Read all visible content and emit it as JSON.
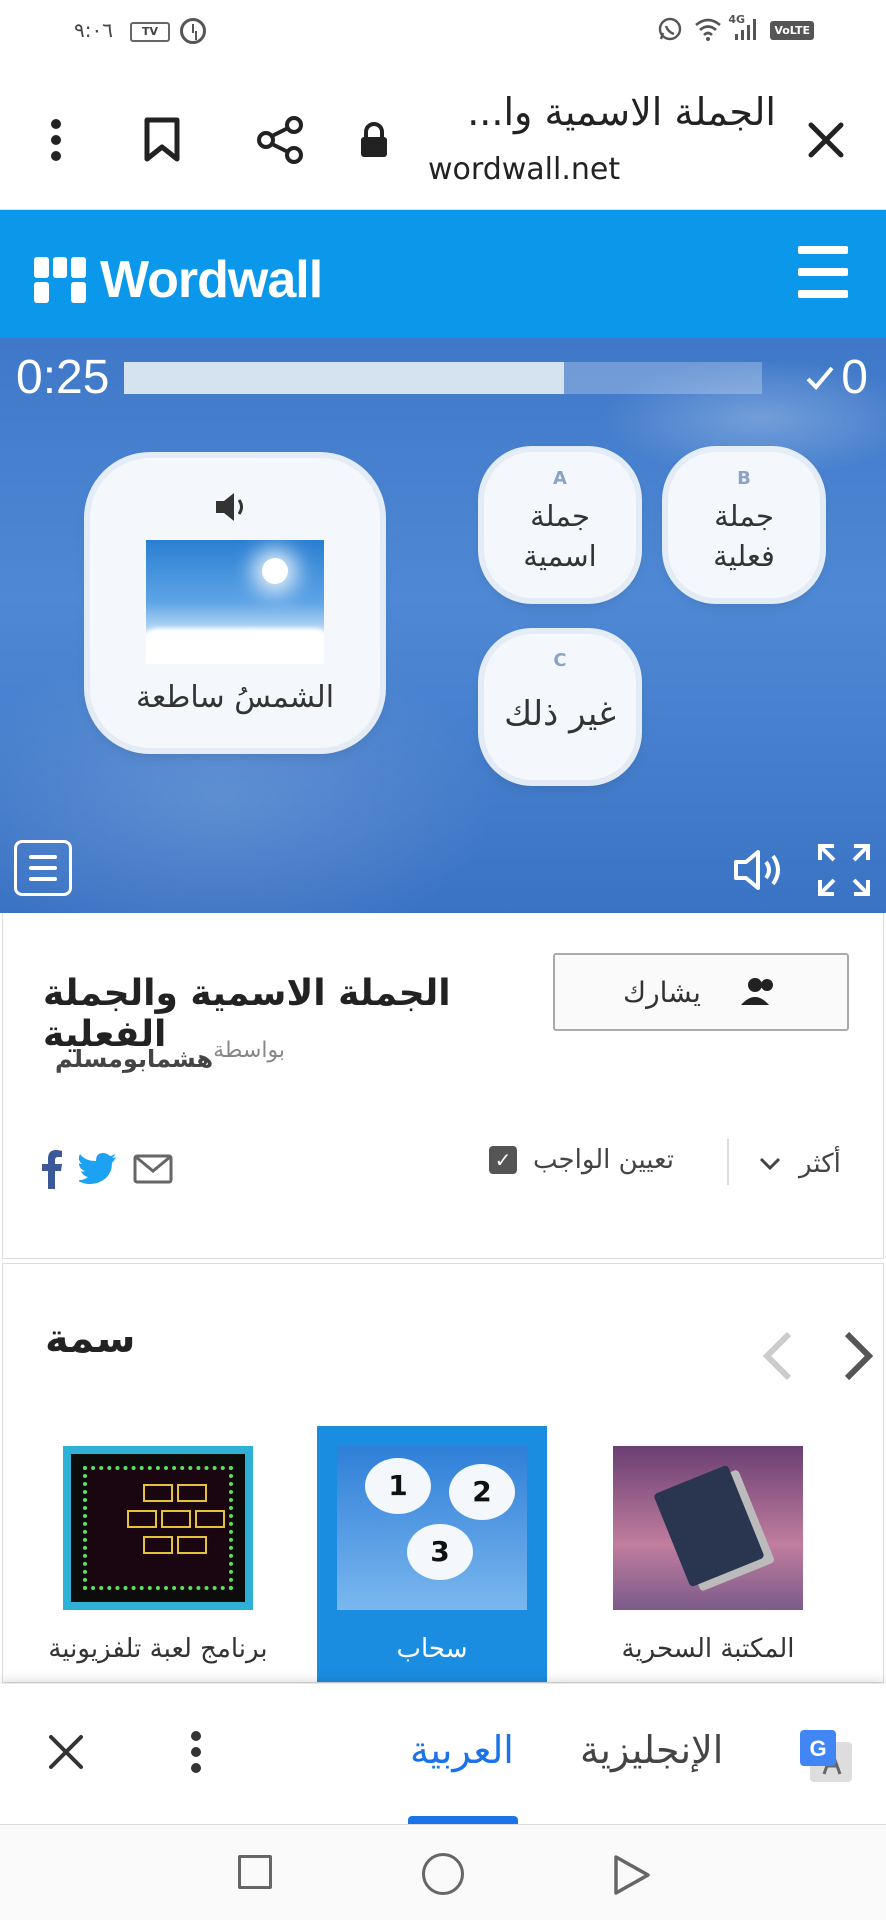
{
  "status_bar": {
    "time": "٩:٠٦",
    "tv_badge": "TV",
    "network": "4G",
    "volte": "VoLTE",
    "icons": [
      "alarm-icon",
      "whatsapp-icon",
      "wifi-icon",
      "signal-icon"
    ]
  },
  "browser": {
    "page_title": "الجملة الاسمية وا...",
    "domain": "wordwall.net",
    "icons": [
      "close-icon",
      "lock-icon",
      "share-icon",
      "bookmark-icon",
      "more-vert-icon"
    ]
  },
  "header": {
    "brand": "Wordwall",
    "colors": {
      "brand_blue": "#0b98ea"
    }
  },
  "game": {
    "timer": "0:25",
    "time_remaining_fraction": 0.69,
    "score": "0",
    "question": {
      "text": "الشمسُ ساطعة",
      "has_audio": true,
      "image": "sky-with-sun"
    },
    "answers": [
      {
        "letter": "A",
        "text": "جملة اسمية"
      },
      {
        "letter": "B",
        "text": "جملة فعلية"
      },
      {
        "letter": "C",
        "text": "غير ذلك"
      }
    ]
  },
  "info": {
    "share_label": "يشارك",
    "title": "الجملة الاسمية والجملة الفعلية",
    "by_label": "بواسطة",
    "author": "هشمابومسلم",
    "assign_label": "تعيين الواجب",
    "assign_checked": true,
    "more_label": "أكثر",
    "social": [
      "facebook-icon",
      "twitter-icon",
      "email-icon"
    ]
  },
  "theme": {
    "title": "سمة",
    "items": [
      {
        "label": "برنامج لعبة تلفزيونية",
        "selected": false
      },
      {
        "label": "سحاب",
        "selected": true
      },
      {
        "label": "المكتبة السحرية",
        "selected": false
      }
    ]
  },
  "translate_bar": {
    "target_lang": "العربية",
    "source_lang": "الإنجليزية",
    "active": "العربية",
    "colors": {
      "active": "#1a73e8"
    }
  }
}
